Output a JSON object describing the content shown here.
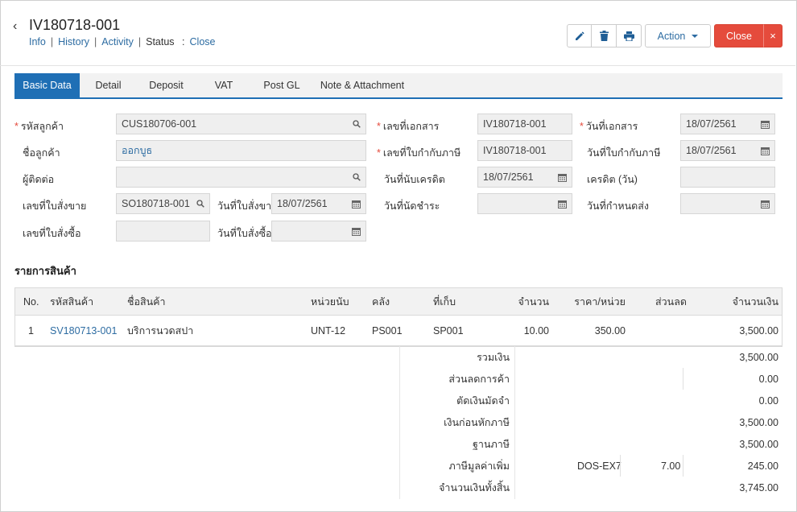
{
  "header": {
    "title": "IV180718-001",
    "links": [
      "Info",
      "History",
      "Activity"
    ],
    "status_label": "Status",
    "status_colon": ":",
    "status_value": "Close"
  },
  "toolbar": {
    "edit_icon": "pencil-icon",
    "delete_icon": "trash-icon",
    "print_icon": "printer-icon",
    "action_label": "Action",
    "close_label": "Close",
    "close_x": "×"
  },
  "tabs": [
    "Basic Data",
    "Detail",
    "Deposit",
    "VAT",
    "Post GL",
    "Note & Attachment"
  ],
  "form": {
    "customer_code_label": "รหัสลูกค้า",
    "customer_code": "CUS180706-001",
    "customer_name_label": "ชื่อลูกค้า",
    "customer_name": "ออกบูธ",
    "contact_label": "ผู้ติดต่อ",
    "contact": "",
    "so_no_label": "เลขที่ใบสั่งขาย",
    "so_no": "SO180718-001",
    "so_date_label": "วันที่ใบสั่งขาย",
    "so_date": "18/07/2561",
    "po_no_label": "เลขที่ใบสั่งซื้อ",
    "po_no": "",
    "po_date_label": "วันที่ใบสั่งซื้อ",
    "po_date": "",
    "doc_no_label": "เลขที่เอกสาร",
    "doc_no": "IV180718-001",
    "tax_inv_no_label": "เลขที่ใบกำกับภาษี",
    "tax_inv_no": "IV180718-001",
    "credit_start_label": "วันที่นับเครดิต",
    "credit_start": "18/07/2561",
    "due_date_label": "วันที่นัดชำระ",
    "due_date": "",
    "doc_date_label": "วันที่เอกสาร",
    "doc_date": "18/07/2561",
    "tax_inv_date_label": "วันที่ใบกำกับภาษี",
    "tax_inv_date": "18/07/2561",
    "credit_days_label": "เครดิต (วัน)",
    "credit_days": "",
    "delivery_date_label": "วันที่กำหนดส่ง",
    "delivery_date": "",
    "required_mark": "*"
  },
  "items_section_title": "รายการสินค้า",
  "table": {
    "columns": [
      "No.",
      "รหัสสินค้า",
      "ชื่อสินค้า",
      "หน่วยนับ",
      "คลัง",
      "ที่เก็บ",
      "จำนวน",
      "ราคา/หน่วย",
      "ส่วนลด",
      "จำนวนเงิน"
    ],
    "rows": [
      [
        "1",
        "SV180713-001",
        "บริการนวดสปา",
        "UNT-12",
        "PS001",
        "SP001",
        "10.00",
        "350.00",
        "",
        "3,500.00"
      ]
    ]
  },
  "summary": [
    {
      "label": "รวมเงิน",
      "value": "3,500.00"
    },
    {
      "label": "ส่วนลดการค้า",
      "value": "0.00"
    },
    {
      "label": "ตัดเงินมัดจำ",
      "value": "0.00"
    },
    {
      "label": "เงินก่อนหักภาษี",
      "value": "3,500.00"
    },
    {
      "label": "ฐานภาษี",
      "value": "3,500.00"
    },
    {
      "label": "ภาษีมูลค่าเพิ่ม",
      "value": "245.00",
      "code": "DOS-EX7",
      "rate": "7.00"
    },
    {
      "label": "จำนวนเงินทั้งสิ้น",
      "value": "3,745.00"
    }
  ]
}
